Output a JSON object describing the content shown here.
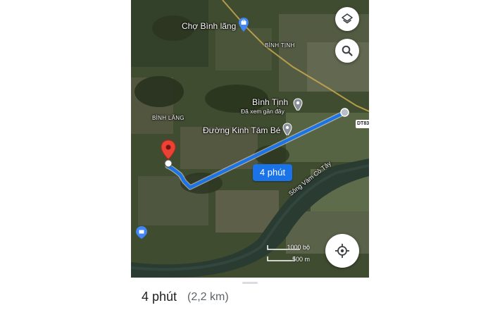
{
  "map": {
    "labels": {
      "cho_binh_lang": "Chợ Bình lãng",
      "binh_tinh_area": "BÌNH TỊNH",
      "binh_tinh_place": "Bình Tịnh",
      "binh_tinh_sub": "Đã xem gần đây",
      "duong_kinh": "Đường Kinh Tám Bé",
      "binh_lang_area": "BÌNH LÃNG",
      "river": "Sông Vàm Cỏ Tây"
    },
    "road_shield": "DT83",
    "route_time_badge": "4 phút",
    "scale": {
      "imperial": "1000 bộ",
      "metric": "500 m"
    },
    "icons": {
      "layers": "layers-icon",
      "search": "search-icon",
      "my_location": "my-location-icon",
      "destination": "destination-pin-icon",
      "shopping": "shopping-bag-icon",
      "place": "place-pin-icon"
    },
    "colors": {
      "route": "#1a73e8",
      "destination_pin": "#ea4335",
      "place_pin": "#8a9099"
    }
  },
  "bottom_sheet": {
    "eta": "4 phút",
    "distance": "(2,2 km)"
  }
}
